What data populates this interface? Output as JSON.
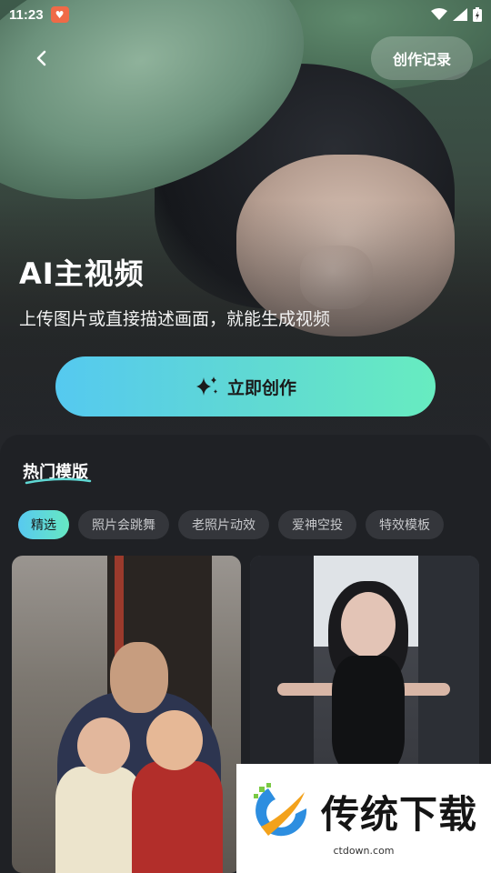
{
  "status_bar": {
    "time": "11:23"
  },
  "header": {
    "record_label": "创作记录"
  },
  "hero": {
    "title": "AI主视频",
    "subtitle": "上传图片或直接描述画面，就能生成视频",
    "cta_label": "立即创作"
  },
  "templates": {
    "section_title": "热门模版",
    "chips": [
      {
        "label": "精选",
        "active": true
      },
      {
        "label": "照片会跳舞",
        "active": false
      },
      {
        "label": "老照片动效",
        "active": false
      },
      {
        "label": "爱神空投",
        "active": false
      },
      {
        "label": "特效模板",
        "active": false
      }
    ]
  },
  "watermark": {
    "title": "传统下载",
    "url": "ctdown.com"
  },
  "colors": {
    "accent_start": "#55c9f0",
    "accent_end": "#67ecc0",
    "background": "#1f2125"
  }
}
